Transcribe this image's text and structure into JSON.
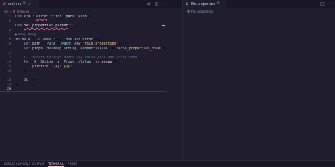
{
  "editor_left": {
    "tab": {
      "label": "main.rs",
      "modified_mark": "U"
    },
    "breadcrumb": [
      "src",
      "main.rs",
      "…"
    ],
    "codelens": "▶ Run | Debug",
    "line_numbers": [
      "5",
      "6",
      "7",
      "8",
      "",
      "9",
      "10",
      "11",
      "12",
      "13",
      "14",
      "15",
      "16",
      "17",
      "18",
      "19",
      "20"
    ]
  },
  "editor_right": {
    "tab": {
      "label": "file.properties",
      "modified_mark": "U"
    },
    "breadcrumb": [
      "file.properties"
    ],
    "line_numbers": [
      "1"
    ]
  },
  "panel": {
    "tabs": [
      "DEBUG CONSOLE",
      "OUTPUT",
      "TERMINAL",
      "PORTS"
    ],
    "active_tab": "TERMINAL"
  },
  "colors": {
    "background": "#1f1d2e",
    "accent": "#ebbcba"
  }
}
